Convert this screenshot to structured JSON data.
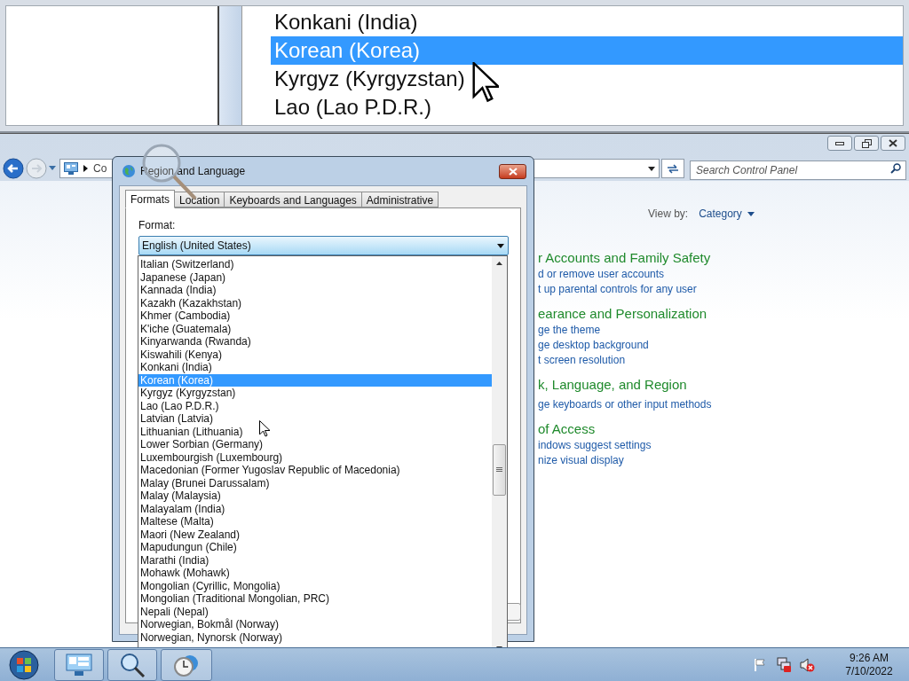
{
  "magnifier_view": {
    "items": [
      {
        "label": "Konkani (India)",
        "selected": false
      },
      {
        "label": "Korean (Korea)",
        "selected": true
      },
      {
        "label": "Kyrgyz (Kyrgyzstan)",
        "selected": false
      },
      {
        "label": "Lao (Lao P.D.R.)",
        "selected": false
      }
    ]
  },
  "control_panel": {
    "address_text": "Co",
    "search": {
      "placeholder": "Search Control Panel"
    },
    "view_by_label": "View by:",
    "view_by_value": "Category",
    "categories": [
      {
        "title": "r Accounts and Family Safety",
        "links": [
          "d or remove user accounts",
          "t up parental controls for any user"
        ]
      },
      {
        "title": "earance and Personalization",
        "links": [
          "ge the theme",
          "ge desktop background",
          "t screen resolution"
        ]
      },
      {
        "title": "k, Language, and Region",
        "links": [
          "ge keyboards or other input methods"
        ]
      },
      {
        "title": "of Access",
        "links": [
          "indows suggest settings",
          "nize visual display"
        ]
      }
    ]
  },
  "dialog": {
    "title": "Region and Language",
    "tabs": [
      {
        "label": "Formats",
        "selected": true
      },
      {
        "label": "Location",
        "selected": false
      },
      {
        "label": "Keyboards and Languages",
        "selected": false
      },
      {
        "label": "Administrative",
        "selected": false
      }
    ],
    "format_label": "Format:",
    "format_value": "English (United States)",
    "dropdown_items": [
      {
        "label": "Italian (Switzerland)",
        "selected": false
      },
      {
        "label": "Japanese (Japan)",
        "selected": false
      },
      {
        "label": "Kannada (India)",
        "selected": false
      },
      {
        "label": "Kazakh (Kazakhstan)",
        "selected": false
      },
      {
        "label": "Khmer (Cambodia)",
        "selected": false
      },
      {
        "label": "K'iche (Guatemala)",
        "selected": false
      },
      {
        "label": "Kinyarwanda (Rwanda)",
        "selected": false
      },
      {
        "label": "Kiswahili (Kenya)",
        "selected": false
      },
      {
        "label": "Konkani (India)",
        "selected": false
      },
      {
        "label": "Korean (Korea)",
        "selected": true
      },
      {
        "label": "Kyrgyz (Kyrgyzstan)",
        "selected": false
      },
      {
        "label": "Lao (Lao P.D.R.)",
        "selected": false
      },
      {
        "label": "Latvian (Latvia)",
        "selected": false
      },
      {
        "label": "Lithuanian (Lithuania)",
        "selected": false
      },
      {
        "label": "Lower Sorbian (Germany)",
        "selected": false
      },
      {
        "label": "Luxembourgish (Luxembourg)",
        "selected": false
      },
      {
        "label": "Macedonian (Former Yugoslav Republic of Macedonia)",
        "selected": false
      },
      {
        "label": "Malay (Brunei Darussalam)",
        "selected": false
      },
      {
        "label": "Malay (Malaysia)",
        "selected": false
      },
      {
        "label": "Malayalam (India)",
        "selected": false
      },
      {
        "label": "Maltese (Malta)",
        "selected": false
      },
      {
        "label": "Maori (New Zealand)",
        "selected": false
      },
      {
        "label": "Mapudungun (Chile)",
        "selected": false
      },
      {
        "label": "Marathi (India)",
        "selected": false
      },
      {
        "label": "Mohawk (Mohawk)",
        "selected": false
      },
      {
        "label": "Mongolian (Cyrillic, Mongolia)",
        "selected": false
      },
      {
        "label": "Mongolian (Traditional Mongolian, PRC)",
        "selected": false
      },
      {
        "label": "Nepali (Nepal)",
        "selected": false
      },
      {
        "label": "Norwegian, Bokmål (Norway)",
        "selected": false
      },
      {
        "label": "Norwegian, Nynorsk (Norway)",
        "selected": false
      }
    ]
  },
  "taskbar": {
    "time": "9:26 AM",
    "date": "7/10/2022"
  }
}
